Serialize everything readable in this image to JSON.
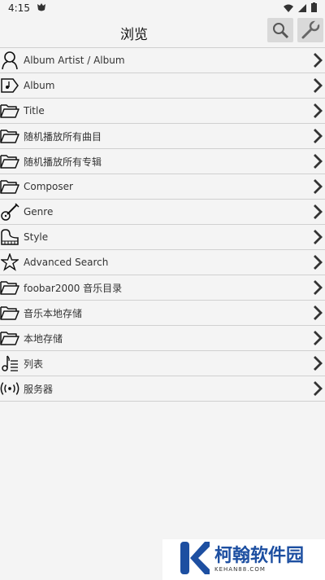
{
  "status": {
    "time": "4:15"
  },
  "header": {
    "title": "浏览"
  },
  "items": [
    {
      "label": "Album Artist / Album",
      "icon": "person-icon"
    },
    {
      "label": "Album",
      "icon": "album-icon"
    },
    {
      "label": "Title",
      "icon": "folder-icon"
    },
    {
      "label": "随机播放所有曲目",
      "icon": "folder-icon"
    },
    {
      "label": "随机播放所有专辑",
      "icon": "folder-icon"
    },
    {
      "label": "Composer",
      "icon": "folder-icon"
    },
    {
      "label": "Genre",
      "icon": "guitar-icon"
    },
    {
      "label": "Style",
      "icon": "piano-icon"
    },
    {
      "label": "Advanced Search",
      "icon": "star-icon"
    },
    {
      "label": "foobar2000 音乐目录",
      "icon": "folder-icon"
    },
    {
      "label": "音乐本地存储",
      "icon": "folder-icon"
    },
    {
      "label": "本地存储",
      "icon": "folder-icon"
    },
    {
      "label": "列表",
      "icon": "playlist-icon"
    },
    {
      "label": "服务器",
      "icon": "server-icon"
    }
  ],
  "watermark": {
    "name": "柯翰软件园",
    "site": "KEHAN88.COM"
  }
}
